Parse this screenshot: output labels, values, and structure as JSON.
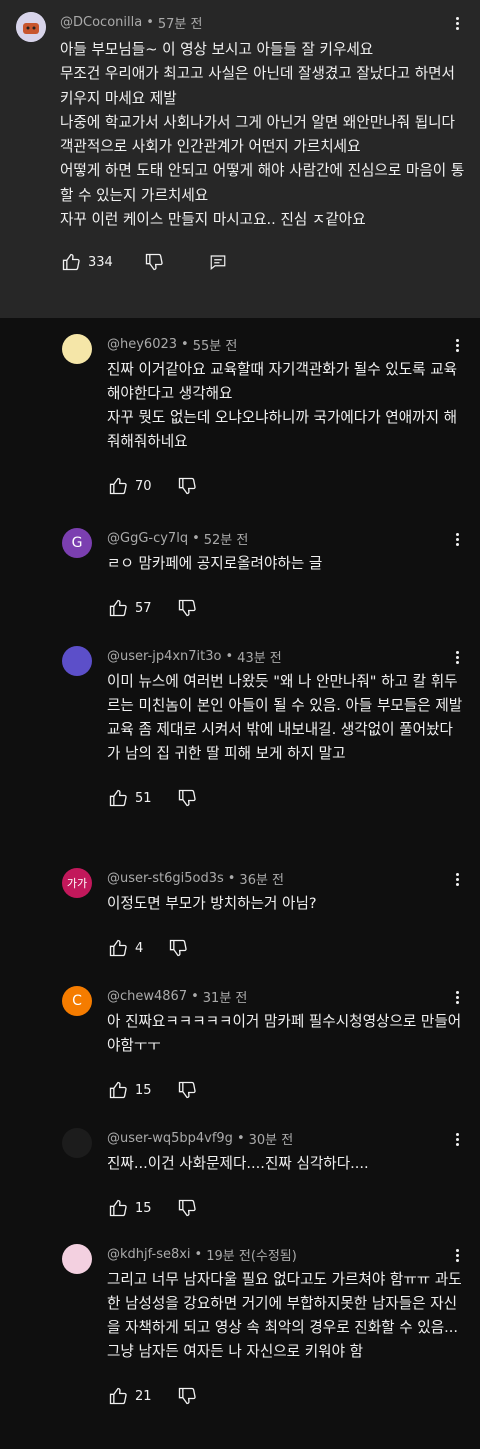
{
  "top_comment": {
    "author": "@DCoconilla",
    "time": "57분 전",
    "text": "아들 부모님들~ 이 영상 보시고 아들들 잘 키우세요\n무조건 우리애가 최고고 사실은 아닌데 잘생겼고 잘났다고 하면서 키우지 마세요 제발\n나중에 학교가서 사회나가서 그게 아닌거 알면 왜안만나줘 됩니다\n객관적으로 사회가 인간관계가 어떤지 가르치세요\n어떻게 하면 도태 안되고 어떻게 해야 사람간에 진심으로 마음이 통할 수 있는지 가르치세요\n자꾸 이런 케이스 만들지 마시고요.. 진심 ㅈ같아요",
    "likes": "334"
  },
  "replies": [
    {
      "author": "@hey6023",
      "time": "55분 전",
      "avatar_letter": "",
      "avatar_color": "#f5e6a8",
      "text": "진짜 이거같아요 교육할때 자기객관화가 될수 있도록 교육해야한다고 생각해요\n자꾸 뭣도 없는데 오냐오냐하니까 국가에다가 연애까지 해줘해줘하네요",
      "likes": "70"
    },
    {
      "author": "@GgG-cy7lq",
      "time": "52분 전",
      "avatar_letter": "G",
      "avatar_color": "#7b3fb0",
      "text": "ㄹㅇ 맘카페에 공지로올려야하는 글",
      "likes": "57"
    },
    {
      "author": "@user-jp4xn7it3o",
      "time": "43분 전",
      "avatar_letter": "",
      "avatar_color": "#5c4fc9",
      "text": "이미 뉴스에 여러번 나왔듯 \"왜 나 안만나줘\" 하고 칼 휘두르는 미친놈이 본인 아들이 될 수 있음. 아들 부모들은 제발 교육 좀 제대로 시켜서 밖에 내보내길. 생각없이 풀어놨다가 남의 집 귀한 딸 피해 보게 하지 말고",
      "likes": "51"
    },
    {
      "author": "@user-st6gi5od3s",
      "time": "36분 전",
      "avatar_letter": "가가",
      "avatar_color": "#c2185b",
      "text": "이정도면 부모가 방치하는거 아님?",
      "likes": "4"
    },
    {
      "author": "@chew4867",
      "time": "31분 전",
      "avatar_letter": "C",
      "avatar_color": "#f57c00",
      "text": "아 진짜요ㅋㅋㅋㅋㅋ이거 맘카페 필수시청영상으로 만들어야함ㅜㅜ",
      "likes": "15"
    },
    {
      "author": "@user-wq5bp4vf9g",
      "time": "30분 전",
      "avatar_letter": "",
      "avatar_color": "#1c1c1c",
      "text": "진짜...이건 사화문제다....진짜 심각하다....",
      "likes": "15"
    },
    {
      "author": "@kdhjf-se8xi",
      "time": "19분 전(수정됨)",
      "avatar_letter": "",
      "avatar_color": "#f3d0e0",
      "text": "그리고 너무 남자다울 필요 없다고도 가르쳐야 함ㅠㅠ 과도한 남성성을 강요하면 거기에 부합하지못한 남자들은 자신을 자책하게 되고 영상 속 최악의 경우로 진화할 수 있음... 그냥 남자든 여자든 나 자신으로 키워야 함",
      "likes": "21"
    }
  ],
  "icons": {
    "like": "thumbs-up-icon",
    "dislike": "thumbs-down-icon",
    "reply": "reply-icon",
    "more": "more-vert-icon"
  }
}
